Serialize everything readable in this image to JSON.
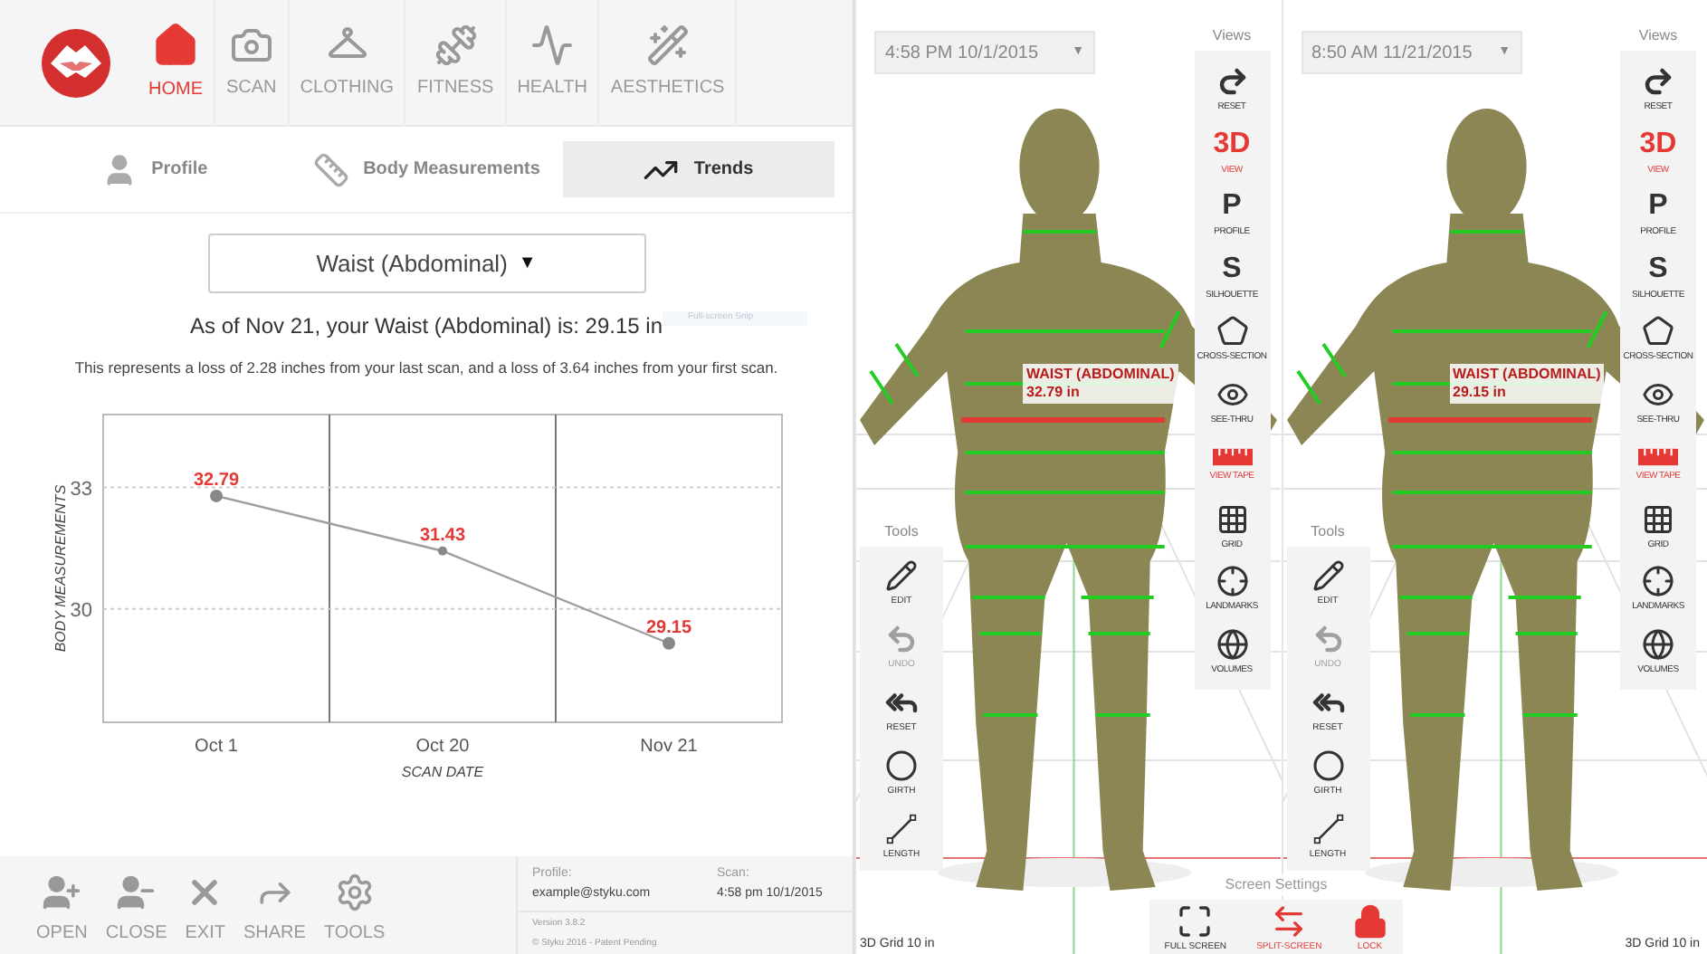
{
  "nav": {
    "items": [
      {
        "label": "HOME",
        "selected": true
      },
      {
        "label": "SCAN",
        "selected": false
      },
      {
        "label": "CLOTHING",
        "selected": false
      },
      {
        "label": "FITNESS",
        "selected": false
      },
      {
        "label": "HEALTH",
        "selected": false
      },
      {
        "label": "AESTHETICS",
        "selected": false
      }
    ]
  },
  "tabs": [
    {
      "label": "Profile",
      "selected": false
    },
    {
      "label": "Body Measurements",
      "selected": false
    },
    {
      "label": "Trends",
      "selected": true
    }
  ],
  "measure_select": {
    "value": "Waist (Abdominal)",
    "caret": "▼"
  },
  "summary": "As of Nov 21, your Waist (Abdominal) is: 29.15 in",
  "snip_label": "Full-screen Snip",
  "detail": "This represents a loss of 2.28 inches from your last scan, and a loss of 3.64 inches from your first scan.",
  "chart_data": {
    "type": "line",
    "xlabel": "SCAN DATE",
    "ylabel": "BODY MEASUREMENTS",
    "categories": [
      "Oct 1",
      "Oct 20",
      "Nov 21"
    ],
    "series": [
      {
        "color": "#9e9e9e",
        "marker": true,
        "values": [
          32.79,
          31.43,
          29.15
        ]
      }
    ],
    "ylim": [
      27.2,
      34.8
    ],
    "yticks": [
      30,
      33
    ],
    "data_labels": true
  },
  "footer": {
    "actions": [
      {
        "label": "OPEN"
      },
      {
        "label": "CLOSE"
      },
      {
        "label": "EXIT"
      },
      {
        "label": "SHARE"
      },
      {
        "label": "TOOLS"
      }
    ],
    "profile_label": "Profile:",
    "profile_value": "example@styku.com",
    "scan_label": "Scan:",
    "scan_value": "4:58 pm 10/1/2015",
    "version": "Version 3.8.2",
    "copyright": "© Styku 2016 - Patent Pending"
  },
  "viewports": [
    {
      "date": "4:58 PM 10/1/2015",
      "date_caret": "▼",
      "measurement_name": "WAIST (ABDOMINAL)",
      "measurement_value": "32.79 in",
      "grid_label": "3D Grid 10 in",
      "views_title": "Views",
      "views": [
        {
          "label": "RESET",
          "kind": "icon",
          "selected": false
        },
        {
          "label": "VIEW",
          "kind": "glyph",
          "glyph": "3D",
          "selected": true
        },
        {
          "label": "PROFILE",
          "kind": "glyph",
          "glyph": "P",
          "selected": false
        },
        {
          "label": "SILHOUETTE",
          "kind": "glyph",
          "glyph": "S",
          "selected": false
        },
        {
          "label": "CROSS-SECTION",
          "kind": "icon",
          "selected": false
        },
        {
          "label": "SEE-THRU",
          "kind": "icon",
          "selected": false
        },
        {
          "label": "VIEW TAPE",
          "kind": "icon",
          "selected": true
        },
        {
          "label": "GRID",
          "kind": "icon",
          "selected": false
        },
        {
          "label": "LANDMARKS",
          "kind": "icon",
          "selected": false
        },
        {
          "label": "VOLUMES",
          "kind": "icon",
          "selected": false
        }
      ],
      "tools_title": "Tools",
      "tools": [
        {
          "label": "EDIT",
          "disabled": false
        },
        {
          "label": "UNDO",
          "disabled": true
        },
        {
          "label": "RESET",
          "disabled": false
        },
        {
          "label": "GIRTH",
          "disabled": false
        },
        {
          "label": "LENGTH",
          "disabled": false
        }
      ]
    },
    {
      "date": "8:50 AM 11/21/2015",
      "date_caret": "▼",
      "measurement_name": "WAIST (ABDOMINAL)",
      "measurement_value": "29.15 in",
      "grid_label": "3D Grid 10 in",
      "views_title": "Views",
      "views": [
        {
          "label": "RESET",
          "kind": "icon",
          "selected": false
        },
        {
          "label": "VIEW",
          "kind": "glyph",
          "glyph": "3D",
          "selected": true
        },
        {
          "label": "PROFILE",
          "kind": "glyph",
          "glyph": "P",
          "selected": false
        },
        {
          "label": "SILHOUETTE",
          "kind": "glyph",
          "glyph": "S",
          "selected": false
        },
        {
          "label": "CROSS-SECTION",
          "kind": "icon",
          "selected": false
        },
        {
          "label": "SEE-THRU",
          "kind": "icon",
          "selected": false
        },
        {
          "label": "VIEW TAPE",
          "kind": "icon",
          "selected": true
        },
        {
          "label": "GRID",
          "kind": "icon",
          "selected": false
        },
        {
          "label": "LANDMARKS",
          "kind": "icon",
          "selected": false
        },
        {
          "label": "VOLUMES",
          "kind": "icon",
          "selected": false
        }
      ],
      "tools_title": "Tools",
      "tools": [
        {
          "label": "EDIT",
          "disabled": false
        },
        {
          "label": "UNDO",
          "disabled": true
        },
        {
          "label": "RESET",
          "disabled": false
        },
        {
          "label": "GIRTH",
          "disabled": false
        },
        {
          "label": "LENGTH",
          "disabled": false
        }
      ]
    }
  ],
  "screen_settings": {
    "title": "Screen Settings",
    "buttons": [
      {
        "label": "FULL SCREEN",
        "selected": false
      },
      {
        "label": "SPLIT-SCREEN",
        "selected": true
      },
      {
        "label": "LOCK",
        "selected": true
      }
    ]
  }
}
